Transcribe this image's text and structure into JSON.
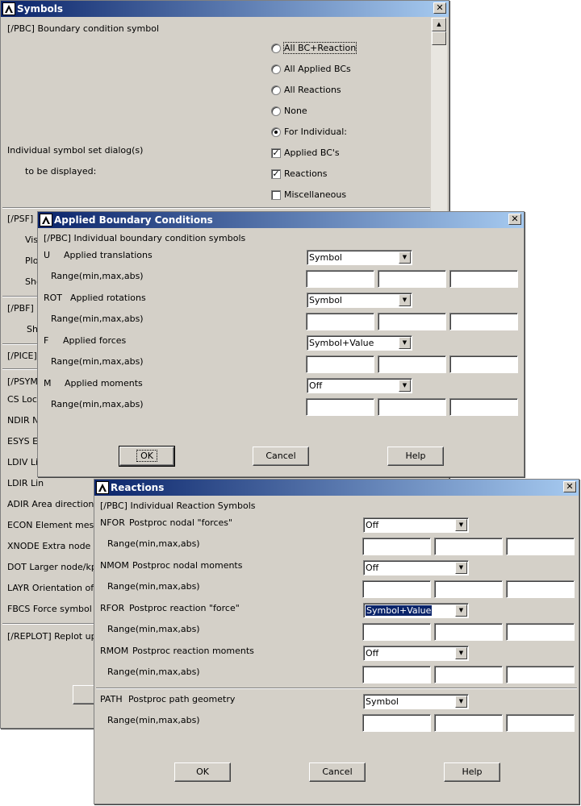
{
  "symbols": {
    "title": "Symbols",
    "close": "✕",
    "pbc_label": "[/PBC] Boundary condition symbol",
    "radios": [
      "All BC+Reaction",
      "All Applied BCs",
      "All Reactions",
      "None",
      "For Individual:"
    ],
    "selected_radio": "For Individual:",
    "individual_label": "Individual symbol set dialog(s)",
    "to_be_displayed": "to be displayed:",
    "checks": [
      {
        "label": "Applied BC's",
        "checked": true
      },
      {
        "label": "Reactions",
        "checked": true
      },
      {
        "label": "Miscellaneous",
        "checked": false
      }
    ],
    "psf": "[/PSF]",
    "psf_visi": "Visi",
    "psf_plot": "Plot",
    "psf_show": "Sho",
    "pbf": "[/PBF]",
    "pbf_show": "Sh",
    "pice": "[/PICE]",
    "psymb": "[/PSYMB",
    "cs": "CS  Loc",
    "ndir": "NDIR No",
    "esys": "ESYS Ele",
    "ldiv": "LDIV  Lin",
    "ldir": "LDIR  Lin",
    "adir": "ADIR  Area direction",
    "econ": "ECON  Element mesh c",
    "xnode": "XNODE  Extra node at",
    "dot": "DOT  Larger node/kp s",
    "layr": "LAYR  Orientation of la",
    "fbcs": "FBCS  Force symbol co",
    "replot": "[/REPLOT]  Replot upon"
  },
  "abc": {
    "title": "Applied Boundary Conditions",
    "close": "✕",
    "header": "[/PBC]  Individual boundary condition symbols",
    "range_label": "Range(min,max,abs)",
    "rows": [
      {
        "code": "U",
        "label": "Applied translations",
        "value": "Symbol"
      },
      {
        "code": "ROT",
        "label": "Applied rotations",
        "value": "Symbol"
      },
      {
        "code": "F",
        "label": "Applied forces",
        "value": "Symbol+Value"
      },
      {
        "code": "M",
        "label": "Applied moments",
        "value": "Off"
      }
    ],
    "ok": "OK",
    "cancel": "Cancel",
    "help": "Help"
  },
  "reactions": {
    "title": "Reactions",
    "close": "✕",
    "header": "[/PBC]  Individual Reaction Symbols",
    "range_label": "Range(min,max,abs)",
    "rows": [
      {
        "code": "NFOR",
        "label": "Postproc nodal \"forces\"",
        "value": "Off"
      },
      {
        "code": "NMOM",
        "label": "Postproc nodal moments",
        "value": "Off"
      },
      {
        "code": "RFOR",
        "label": "Postproc reaction \"force\"",
        "value": "Symbol+Value"
      },
      {
        "code": "RMOM",
        "label": "Postproc reaction moments",
        "value": "Off"
      }
    ],
    "path": {
      "code": "PATH",
      "label": "Postproc path geometry",
      "value": "Symbol"
    },
    "ok": "OK",
    "cancel": "Cancel",
    "help": "Help"
  }
}
